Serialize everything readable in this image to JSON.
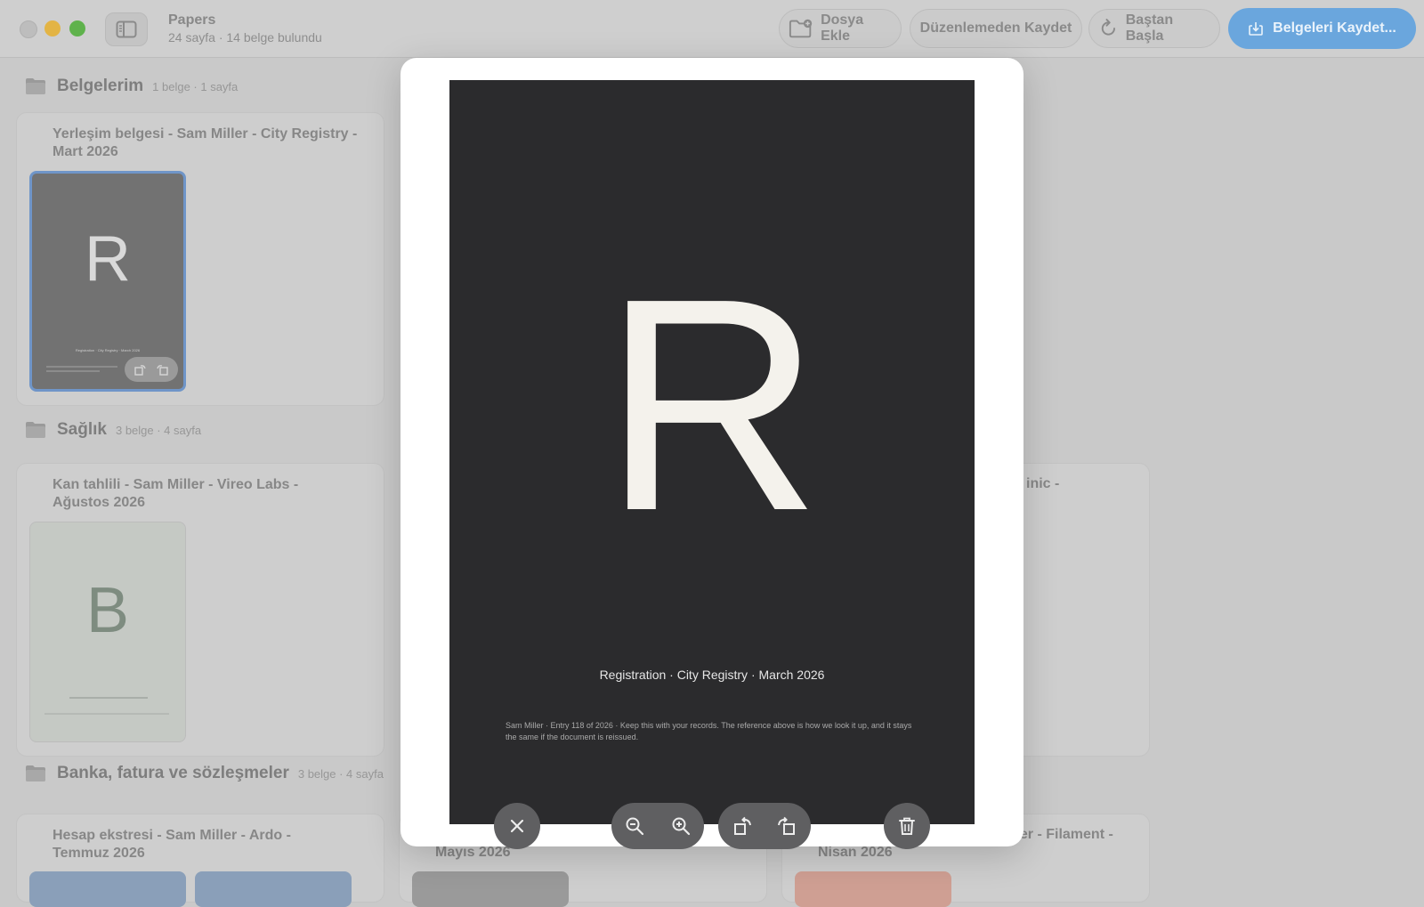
{
  "window": {
    "app_title": "Papers",
    "app_subtitle": "24 sayfa · 14 belge bulundu"
  },
  "toolbar": {
    "add_file_label": "Dosya Ekle",
    "save_without_edit_label": "Düzenlemeden Kaydet",
    "start_over_label": "Baştan Başla",
    "save_documents_label": "Belgeleri Kaydet..."
  },
  "sections": [
    {
      "title": "Belgelerim",
      "meta": "1 belge · 1 sayfa",
      "cards": [
        {
          "title_line1": "Yerleşim belgesi - Sam Miller - City Registry -",
          "title_line2": "Mart 2026",
          "thumb_letter": "R",
          "thumb_caption": "Registration · City Registry · March 2026"
        }
      ]
    },
    {
      "title": "Sağlık",
      "meta": "3 belge · 4 sayfa",
      "cards": [
        {
          "title_line1": "Kan tahlili - Sam Miller - Vireo Labs -",
          "title_line2": "Ağustos 2026",
          "thumb_letter": "B"
        },
        {
          "title_fragment": "inic -"
        }
      ]
    },
    {
      "title": "Banka, fatura ve sözleşmeler",
      "meta": "3 belge · 4 sayfa",
      "cards": [
        {
          "title_line1": "Hesap ekstresi - Sam Miller - Ardo -",
          "title_line2": "Temmuz 2026"
        },
        {
          "title_line2": "Mayıs 2026"
        },
        {
          "title_fragment": "ller - Filament -",
          "title_line2": "Nisan 2026"
        }
      ]
    }
  ],
  "preview": {
    "letter": "R",
    "caption": "Registration · City Registry · March 2026",
    "note": "Sam Miller · Entry 118 of 2026 · Keep this with your records. The reference above is how we look it up, and it stays the same if the document is reissued."
  },
  "icons": {
    "close": "close-icon",
    "zoom_out": "zoom-out-icon",
    "zoom_in": "zoom-in-icon",
    "rotate_left": "rotate-left-icon",
    "rotate_right": "rotate-right-icon",
    "delete": "trash-icon"
  },
  "colors": {
    "accent": "#6aa6dd",
    "page_background": "#2b2b2d"
  }
}
